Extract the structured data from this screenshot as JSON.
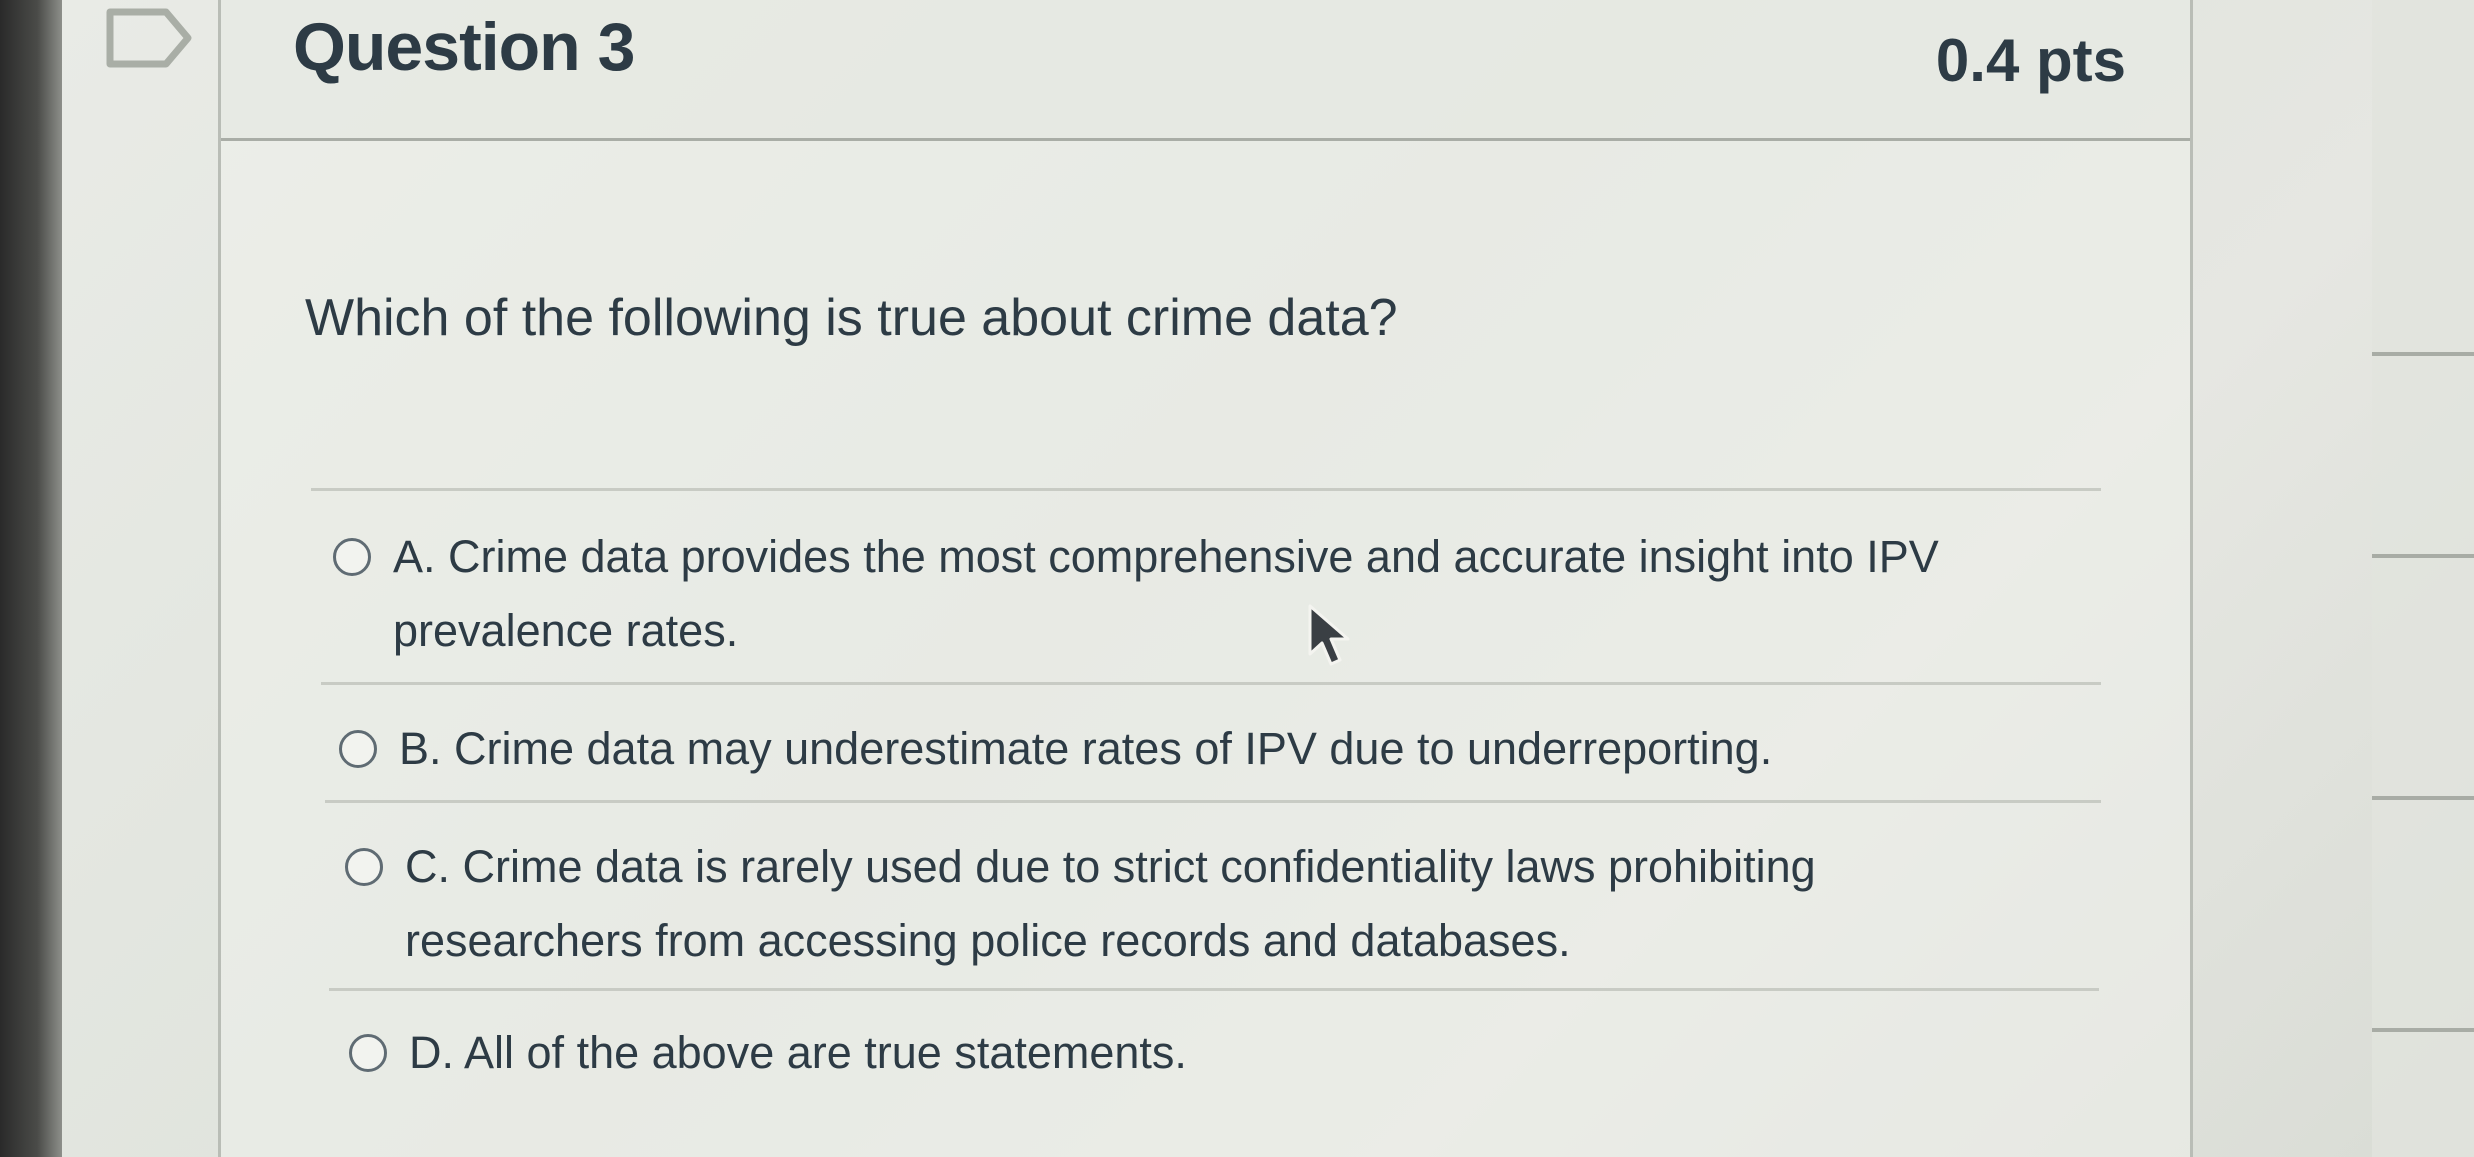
{
  "question": {
    "title": "Question 3",
    "points": "0.4 pts",
    "text": "Which of the following is true about crime data?"
  },
  "answers": [
    {
      "label": "A. Crime data provides the most comprehensive and accurate insight into IPV prevalence rates.",
      "selected": false
    },
    {
      "label": "B. Crime data may underestimate rates of IPV due to underreporting.",
      "selected": false
    },
    {
      "label": "C. Crime data is rarely used due to strict confidentiality laws prohibiting researchers from accessing police records and databases.",
      "selected": false
    },
    {
      "label": "D. All of the above are true statements.",
      "selected": false
    }
  ],
  "icons": {
    "flag": "flag-question-icon",
    "cursor": "mouse-pointer-icon",
    "radio": "radio-button-icon"
  },
  "colors": {
    "text": "#2d3b45",
    "background": "#e2e4df"
  }
}
